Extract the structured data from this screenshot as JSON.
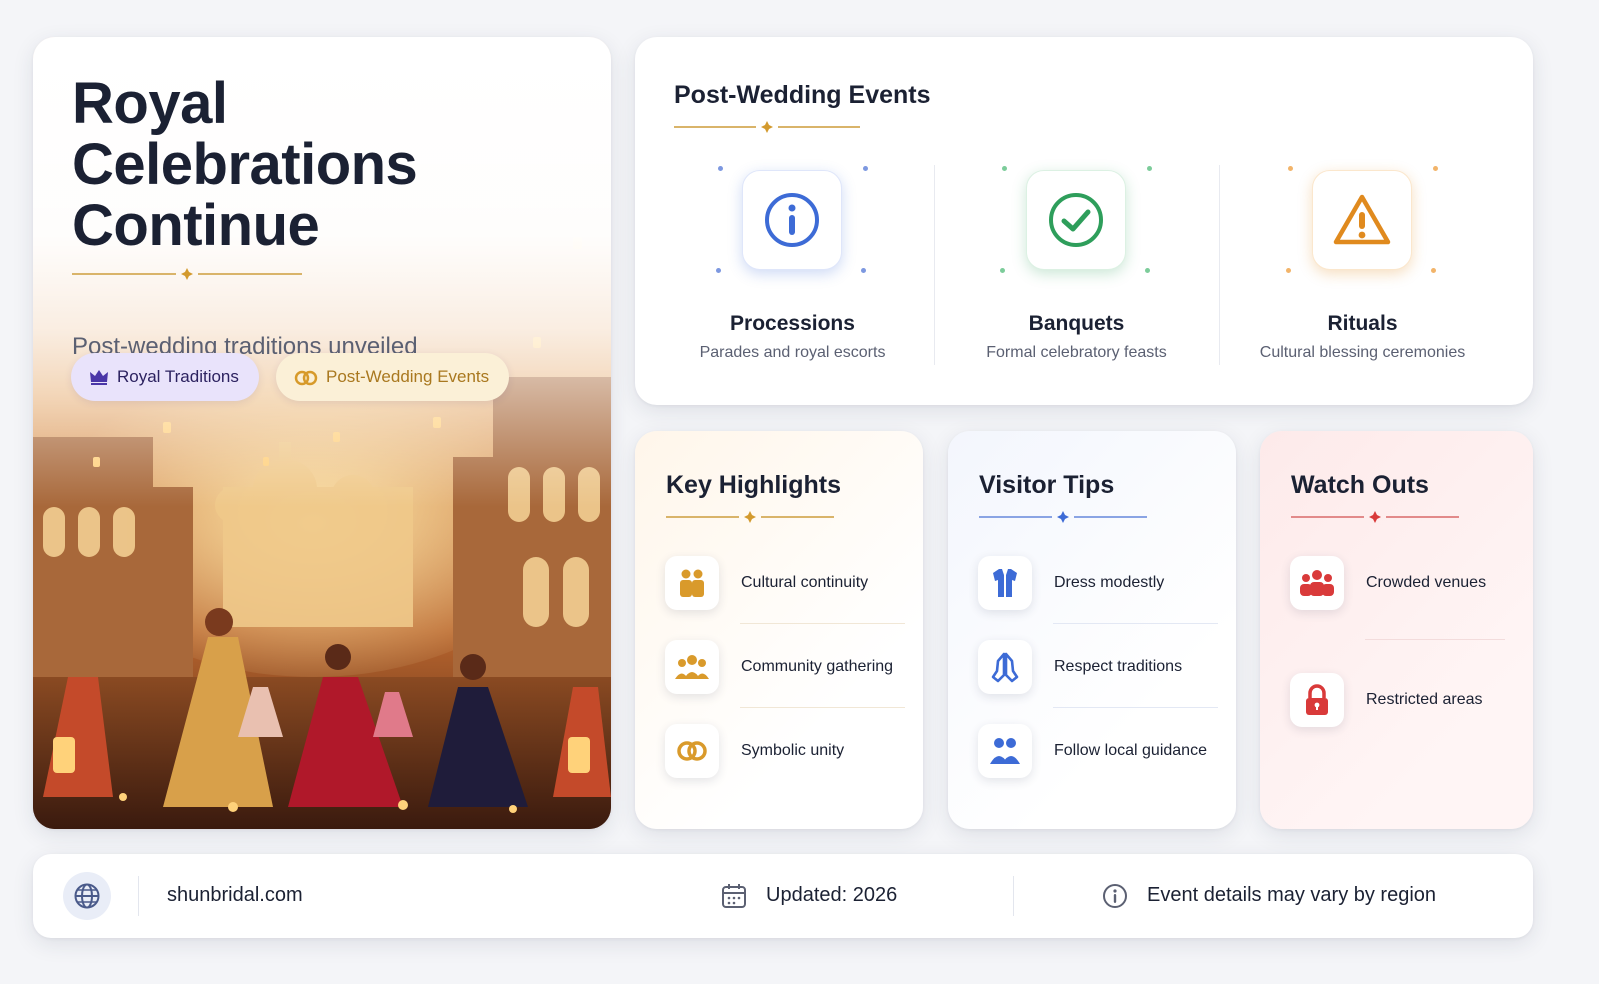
{
  "hero": {
    "title_lines": [
      "Royal",
      "Celebrations",
      "Continue"
    ],
    "subtitle": "Post-wedding traditions unveiled",
    "tags": [
      {
        "label": "Royal Traditions",
        "icon": "crown-icon"
      },
      {
        "label": "Post-Wedding Events",
        "icon": "rings-icon"
      }
    ]
  },
  "events": {
    "title": "Post-Wedding Events",
    "items": [
      {
        "name": "Processions",
        "desc": "Parades and royal escorts",
        "icon": "info-icon",
        "color": "#3d6bd6"
      },
      {
        "name": "Banquets",
        "desc": "Formal celebratory feasts",
        "icon": "check-circle-icon",
        "color": "#2e9e5b"
      },
      {
        "name": "Rituals",
        "desc": "Cultural blessing ceremonies",
        "icon": "warning-icon",
        "color": "#e08a1e"
      }
    ]
  },
  "highlights": {
    "title": "Key Highlights",
    "accent": "#d99a2b",
    "items": [
      {
        "label": "Cultural continuity",
        "icon": "people-pair-icon"
      },
      {
        "label": "Community gathering",
        "icon": "group-icon"
      },
      {
        "label": "Symbolic unity",
        "icon": "rings-icon"
      }
    ]
  },
  "tips": {
    "title": "Visitor Tips",
    "accent": "#3d6bd6",
    "items": [
      {
        "label": "Dress modestly",
        "icon": "garment-icon"
      },
      {
        "label": "Respect traditions",
        "icon": "praying-hands-icon"
      },
      {
        "label": "Follow local guidance",
        "icon": "people-icon"
      }
    ]
  },
  "watch": {
    "title": "Watch Outs",
    "accent": "#d93a3a",
    "items": [
      {
        "label": "Crowded venues",
        "icon": "crowd-icon"
      },
      {
        "label": "Restricted areas",
        "icon": "lock-icon"
      }
    ]
  },
  "footer": {
    "site": "shunbridal.com",
    "updated": "Updated: 2026",
    "note": "Event details may vary by region"
  }
}
